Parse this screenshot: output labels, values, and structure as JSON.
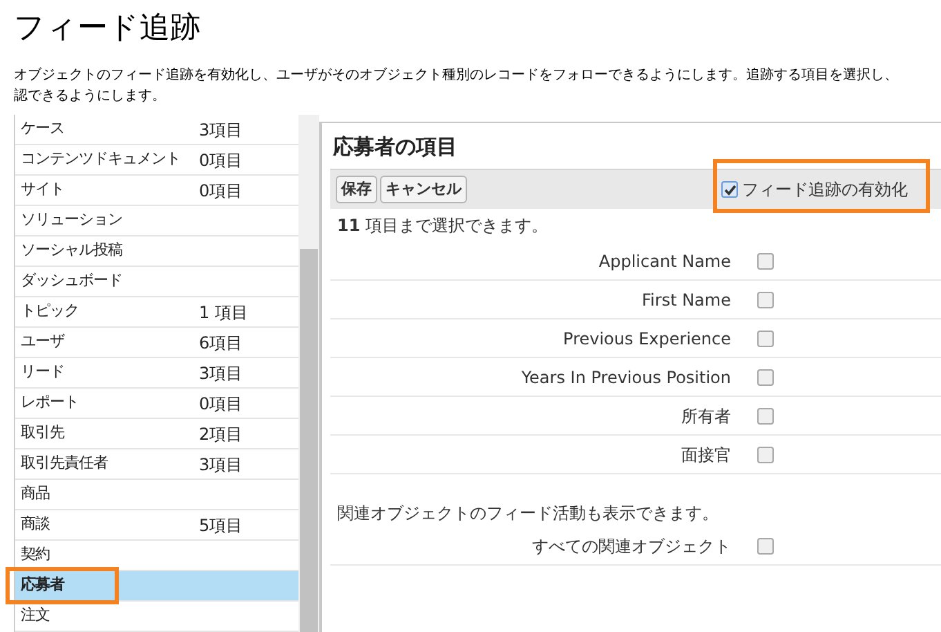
{
  "page": {
    "title": "フィード追跡",
    "description_lines": [
      "オブジェクトのフィード追跡を有効化し、ユーザがそのオブジェクト種別のレコードをフォローできるようにします。追跡する項目を選択し、",
      "認できるようにします。"
    ]
  },
  "objects": [
    {
      "name": "ケース",
      "count": "3項目",
      "selected": false,
      "highlighted": false
    },
    {
      "name": "コンテンツドキュメント",
      "count": "0項目",
      "selected": false,
      "highlighted": false
    },
    {
      "name": "サイト",
      "count": "0項目",
      "selected": false,
      "highlighted": false
    },
    {
      "name": "ソリューション",
      "selected": false,
      "highlighted": false
    },
    {
      "name": "ソーシャル投稿",
      "selected": false,
      "highlighted": false
    },
    {
      "name": "ダッシュボード",
      "selected": false,
      "highlighted": false
    },
    {
      "name": "トピック",
      "count": "1 項目",
      "selected": false,
      "highlighted": false
    },
    {
      "name": "ユーザ",
      "count": "6項目",
      "selected": false,
      "highlighted": false
    },
    {
      "name": "リード",
      "count": "3項目",
      "selected": false,
      "highlighted": false
    },
    {
      "name": "レポート",
      "count": "0項目",
      "selected": false,
      "highlighted": false
    },
    {
      "name": "取引先",
      "count": "2項目",
      "selected": false,
      "highlighted": false
    },
    {
      "name": "取引先責任者",
      "count": "3項目",
      "selected": false,
      "highlighted": false
    },
    {
      "name": "商品",
      "selected": false,
      "highlighted": false
    },
    {
      "name": "商談",
      "count": "5項目",
      "selected": false,
      "highlighted": false
    },
    {
      "name": "契約",
      "selected": false,
      "highlighted": false
    },
    {
      "name": "応募者",
      "selected": true,
      "highlighted": true
    },
    {
      "name": "注文",
      "selected": false,
      "highlighted": false
    }
  ],
  "panel": {
    "title": "応募者の項目",
    "buttons": [
      "保存",
      "キャンセル"
    ],
    "enable_toggle": {
      "label": "フィード追跡の有効化",
      "checked": true,
      "highlighted": true
    },
    "limit_note": "**11** 項目まで選択できます。",
    "fields": [
      {
        "label": "Applicant Name",
        "checked": false
      },
      {
        "label": "First Name",
        "checked": false
      },
      {
        "label": "Previous Experience",
        "checked": false
      },
      {
        "label": "Years In Previous Position",
        "checked": false
      },
      {
        "label": "所有者",
        "checked": false
      },
      {
        "label": "面接官",
        "checked": false
      }
    ],
    "related_note": "関連オブジェクトのフィード活動も表示できます。",
    "related_fields": [
      {
        "label": "すべての関連オブジェクト",
        "checked": false
      }
    ]
  }
}
